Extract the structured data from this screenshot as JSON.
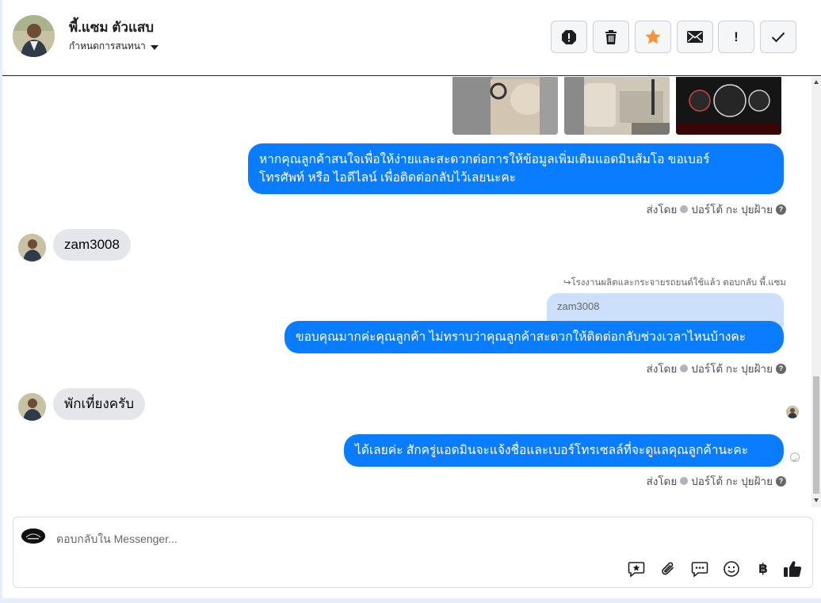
{
  "header": {
    "contact_name": "พี้.แซม ตัวแสบ",
    "assign_label": "กำหนดการสนทนา",
    "actions": [
      {
        "name": "report-spam",
        "icon": "alert-octagon-icon"
      },
      {
        "name": "delete",
        "icon": "trash-icon"
      },
      {
        "name": "star",
        "icon": "star-icon",
        "color": "#f7923a"
      },
      {
        "name": "mark-unread",
        "icon": "envelope-icon"
      },
      {
        "name": "follow-up",
        "icon": "exclamation-icon",
        "label": "!"
      },
      {
        "name": "mark-done",
        "icon": "check-icon"
      }
    ]
  },
  "messages": [
    {
      "type": "outgoing",
      "text_line1": "หากคุณลูกค้าสนใจเพื่อให้ง่ายและสะดวกต่อการให้ข้อมูลเพิ่มเติมแอดมินส้มโอ ขอเบอร์",
      "text_line2": "โทรศัพท์ หรือ ไอดีไลน์ เพื่อติดต่อกลับไว้เลยนะคะ",
      "meta": "ส่งโดย",
      "sender": "ปอร์โต้ กะ ปุยฝ้าย"
    },
    {
      "type": "incoming",
      "text": "zam3008"
    },
    {
      "type": "outgoing-reply",
      "reply_note": "โรงงานผลิตและกระจายรถยนต์ใช้แล้ว ตอบกลับ พี้.แซม",
      "quoted": "zam3008",
      "text": "ขอบคุณมากค่ะคุณลูกค้า ไม่ทราบว่าคุณลูกค้าสะดวกให้ติดต่อกลับช่วงเวลาไหนบ้างคะ",
      "meta": "ส่งโดย",
      "sender": "ปอร์โต้ กะ ปุยฝ้าย"
    },
    {
      "type": "incoming",
      "text": "พักเที่ยงครับ"
    },
    {
      "type": "outgoing",
      "text": "ได้เลยค่ะ สักครู่แอดมินจะแจ้งชื่อและเบอร์โทรเซลล์ที่จะดูแลคุณลูกค้านะคะ",
      "meta": "ส่งโดย",
      "sender": "ปอร์โต้ กะ ปุยฝ้าย"
    }
  ],
  "composer": {
    "placeholder": "ตอบกลับใน Messenger...",
    "tools": [
      "saved-reply-icon",
      "attachment-icon",
      "chat-bubble-icon",
      "emoji-icon",
      "baht-icon",
      "thumbs-up-icon"
    ],
    "baht_symbol": "฿"
  },
  "colors": {
    "outgoing_bubble": "#0a7cff",
    "incoming_bubble": "#e4e6eb",
    "quote_bubble": "#cde0fb"
  }
}
